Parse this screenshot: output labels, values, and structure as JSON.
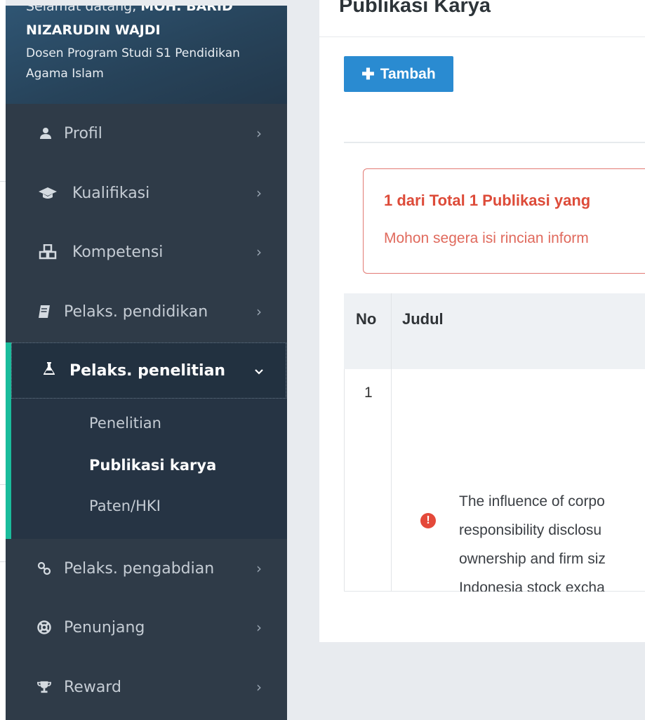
{
  "user": {
    "greeting": "Selamat datang, ",
    "greeting_name": "MOH. BARID",
    "name": "NIZARUDIN WAJDI",
    "role": "Dosen Program Studi S1 Pendidikan Agama Islam"
  },
  "sidebar": {
    "items": [
      {
        "label": "Profil",
        "icon": "user-icon"
      },
      {
        "label": "Kualifikasi",
        "icon": "graduation-cap-icon"
      },
      {
        "label": "Kompetensi",
        "icon": "cubes-icon"
      },
      {
        "label": "Pelaks. pendidikan",
        "icon": "book-icon"
      },
      {
        "label": "Pelaks. penelitian",
        "icon": "flask-icon"
      },
      {
        "label": "Pelaks. pengabdian",
        "icon": "link-icon"
      },
      {
        "label": "Penunjang",
        "icon": "life-ring-icon"
      },
      {
        "label": "Reward",
        "icon": "trophy-icon"
      }
    ],
    "submenu": [
      {
        "label": "Penelitian"
      },
      {
        "label": "Publikasi karya"
      },
      {
        "label": "Paten/HKI"
      }
    ]
  },
  "main": {
    "title": "Publikasi Karya",
    "add_button": "Tambah",
    "alert": {
      "title": "1 dari Total 1 Publikasi yang",
      "text": "Mohon segera isi rincian inform"
    },
    "table": {
      "headers": [
        "No",
        "Judul"
      ],
      "rows": [
        {
          "no": "1",
          "title_lines": [
            "The influence of corpo",
            "responsibility disclosu",
            "ownership and firm siz",
            "Indonesia stock excha"
          ]
        }
      ]
    }
  },
  "colors": {
    "sidebar_bg": "#2f3b48",
    "accent_bar": "#1abc9c",
    "primary_button": "#2a8bd1",
    "alert_red": "#dd4b39"
  }
}
